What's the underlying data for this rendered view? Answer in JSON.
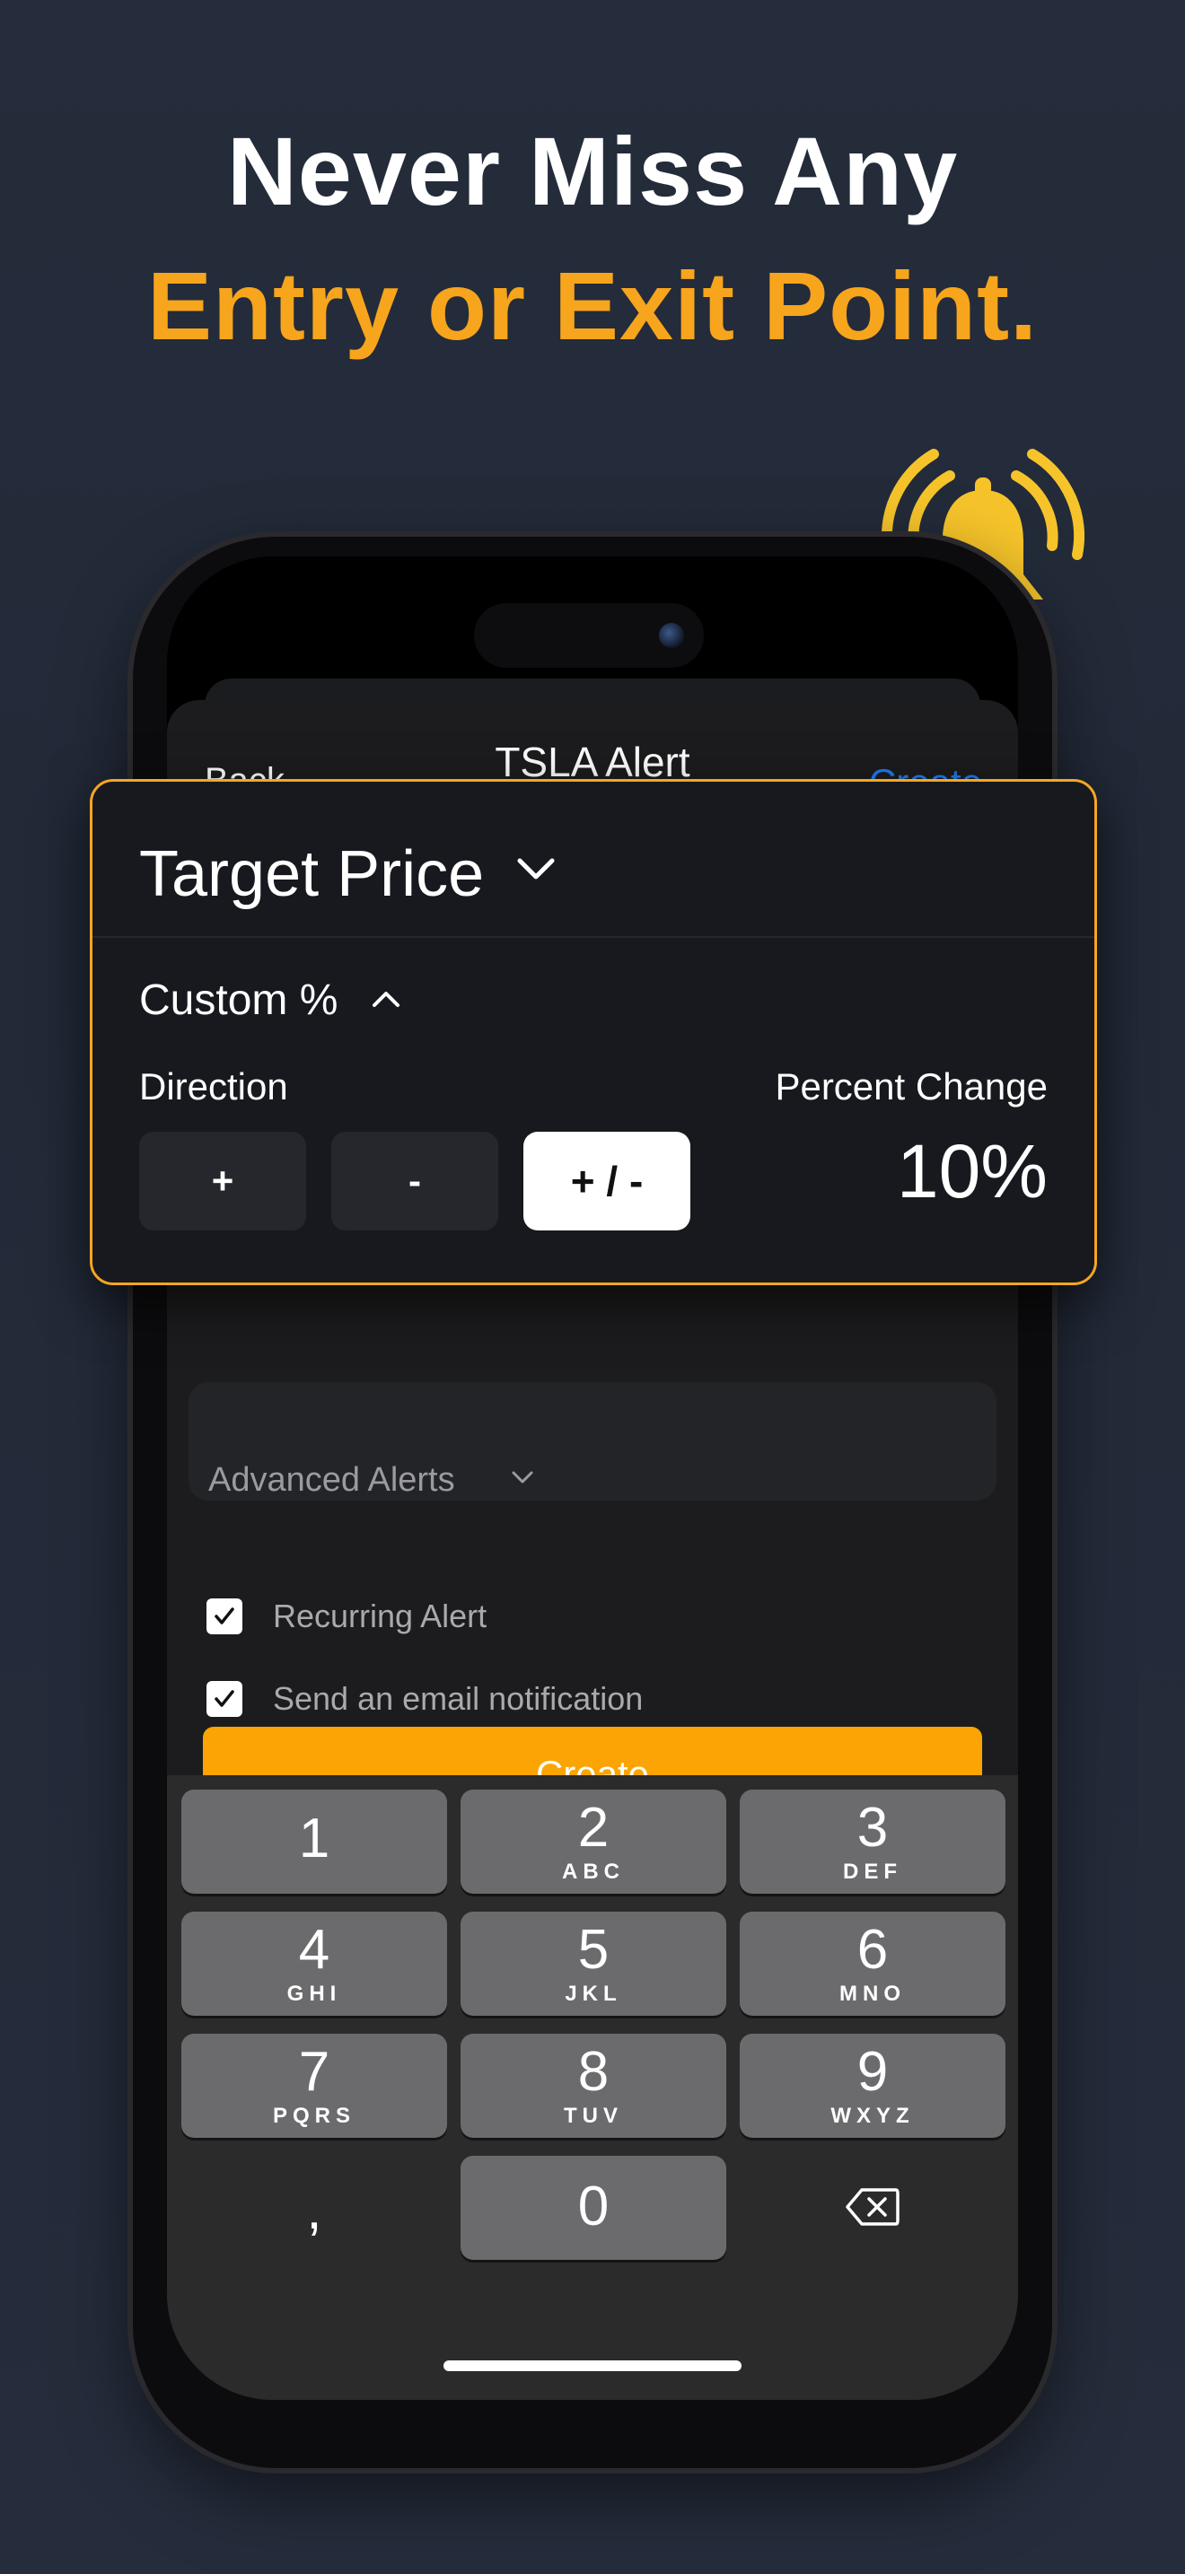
{
  "headline": {
    "line1": "Never Miss Any",
    "line2": "Entry or Exit Point."
  },
  "nav": {
    "back": "Back",
    "title": "TSLA Alert",
    "create": "Create"
  },
  "alert_card": {
    "title": "Target Price",
    "custom_label": "Custom %",
    "direction_label": "Direction",
    "percent_change_label": "Percent Change",
    "direction_options": [
      "+",
      "-",
      "+ / -"
    ],
    "selected_direction": "+ / -",
    "percent_value": "10%"
  },
  "advanced": {
    "label": "Advanced Alerts"
  },
  "options": {
    "recurring": "Recurring Alert",
    "email": "Send an email notification"
  },
  "create_button": "Create",
  "keyboard": {
    "keys": [
      {
        "num": "1",
        "letters": ""
      },
      {
        "num": "2",
        "letters": "ABC"
      },
      {
        "num": "3",
        "letters": "DEF"
      },
      {
        "num": "4",
        "letters": "GHI"
      },
      {
        "num": "5",
        "letters": "JKL"
      },
      {
        "num": "6",
        "letters": "MNO"
      },
      {
        "num": "7",
        "letters": "PQRS"
      },
      {
        "num": "8",
        "letters": "TUV"
      },
      {
        "num": "9",
        "letters": "WXYZ"
      }
    ],
    "comma": ",",
    "zero": "0"
  },
  "colors": {
    "accent": "#f7a51c",
    "create_button": "#fba404",
    "link": "#1e7bf2",
    "bell": "#f6c42a"
  }
}
